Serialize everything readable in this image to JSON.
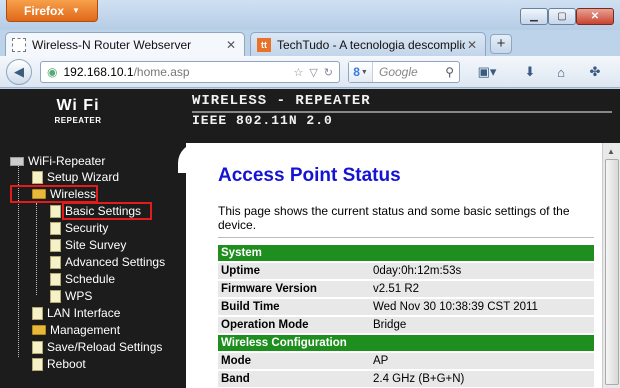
{
  "browser": {
    "menu_button": "Firefox",
    "tabs": [
      {
        "label": "Wireless-N Router Webserver",
        "active": true
      },
      {
        "label": "TechTudo - A tecnologia descomplic...",
        "active": false,
        "favicon_text": "tt"
      }
    ],
    "url_host": "192.168.10.1",
    "url_path": "/home.asp",
    "search_placeholder": "Google",
    "search_engine_glyph": "8",
    "colors": {
      "firefox_orange": "#e0681a",
      "chrome_blue": "#cfe0f2"
    }
  },
  "router": {
    "logo_top": "Wi Fi",
    "logo_bottom": "REPEATER",
    "banner_line1": "WIRELESS - REPEATER",
    "banner_line2": "IEEE 802.11N 2.0",
    "sidebar": {
      "root": "WiFi-Repeater",
      "items": [
        {
          "label": "Setup Wizard",
          "type": "page",
          "level": 1
        },
        {
          "label": "Wireless",
          "type": "folder",
          "level": 1,
          "highlighted": true
        },
        {
          "label": "Basic Settings",
          "type": "page",
          "level": 2,
          "highlighted": true
        },
        {
          "label": "Security",
          "type": "page",
          "level": 2
        },
        {
          "label": "Site Survey",
          "type": "page",
          "level": 2
        },
        {
          "label": "Advanced Settings",
          "type": "page",
          "level": 2
        },
        {
          "label": "Schedule",
          "type": "page",
          "level": 2
        },
        {
          "label": "WPS",
          "type": "page",
          "level": 2
        },
        {
          "label": "LAN Interface",
          "type": "page",
          "level": 1
        },
        {
          "label": "Management",
          "type": "folder",
          "level": 1
        },
        {
          "label": "Save/Reload Settings",
          "type": "page",
          "level": 1
        },
        {
          "label": "Reboot",
          "type": "page",
          "level": 1
        }
      ]
    },
    "page_title": "Access Point Status",
    "description": "This page shows the current status and some basic settings of the device.",
    "sections": [
      {
        "title": "System",
        "rows": [
          {
            "key": "Uptime",
            "value": "0day:0h:12m:53s"
          },
          {
            "key": "Firmware Version",
            "value": "v2.51 R2"
          },
          {
            "key": "Build Time",
            "value": "Wed Nov 30 10:38:39 CST 2011"
          },
          {
            "key": "Operation Mode",
            "value": "Bridge"
          }
        ]
      },
      {
        "title": "Wireless Configuration",
        "rows": [
          {
            "key": "Mode",
            "value": "AP"
          },
          {
            "key": "Band",
            "value": "2.4 GHz (B+G+N)"
          }
        ]
      }
    ],
    "colors": {
      "title_blue": "#1414d2",
      "section_green": "#1e8f1e",
      "highlight_red": "#e21b1b",
      "sidebar_bg": "#1c1c1c"
    }
  }
}
